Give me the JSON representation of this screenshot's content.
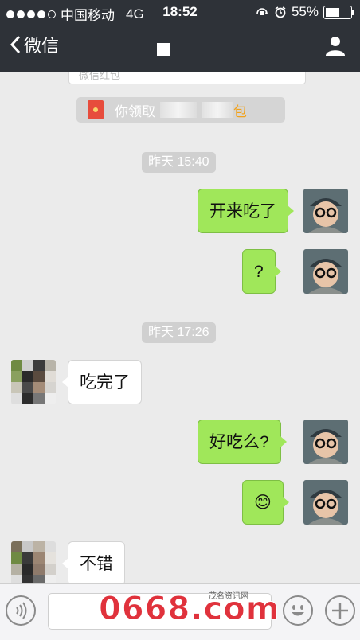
{
  "status_bar": {
    "carrier": "中国移动",
    "network": "4G",
    "time": "18:52",
    "battery_percent": "55%",
    "battery_level": 0.55
  },
  "nav": {
    "back_label": "微信"
  },
  "chat": {
    "top_card_text": "微信红包",
    "system_message": {
      "prefix": "你领取",
      "suffix": "包"
    },
    "timestamps": [
      "昨天 15:40",
      "昨天 17:26"
    ],
    "messages": [
      {
        "from": "me",
        "text": "开来吃了"
      },
      {
        "from": "me",
        "text": "?"
      },
      {
        "from": "them",
        "text": "吃完了"
      },
      {
        "from": "me",
        "text": "好吃么?"
      },
      {
        "from": "me",
        "text": "😊"
      },
      {
        "from": "them",
        "text": "不错"
      }
    ]
  },
  "watermark": {
    "text": "0668.com",
    "subtext": "茂名资讯网"
  },
  "colors": {
    "navbar": "#2e3238",
    "my_bubble": "#a0e75a",
    "their_bubble": "#ffffff",
    "background": "#ebebeb"
  }
}
